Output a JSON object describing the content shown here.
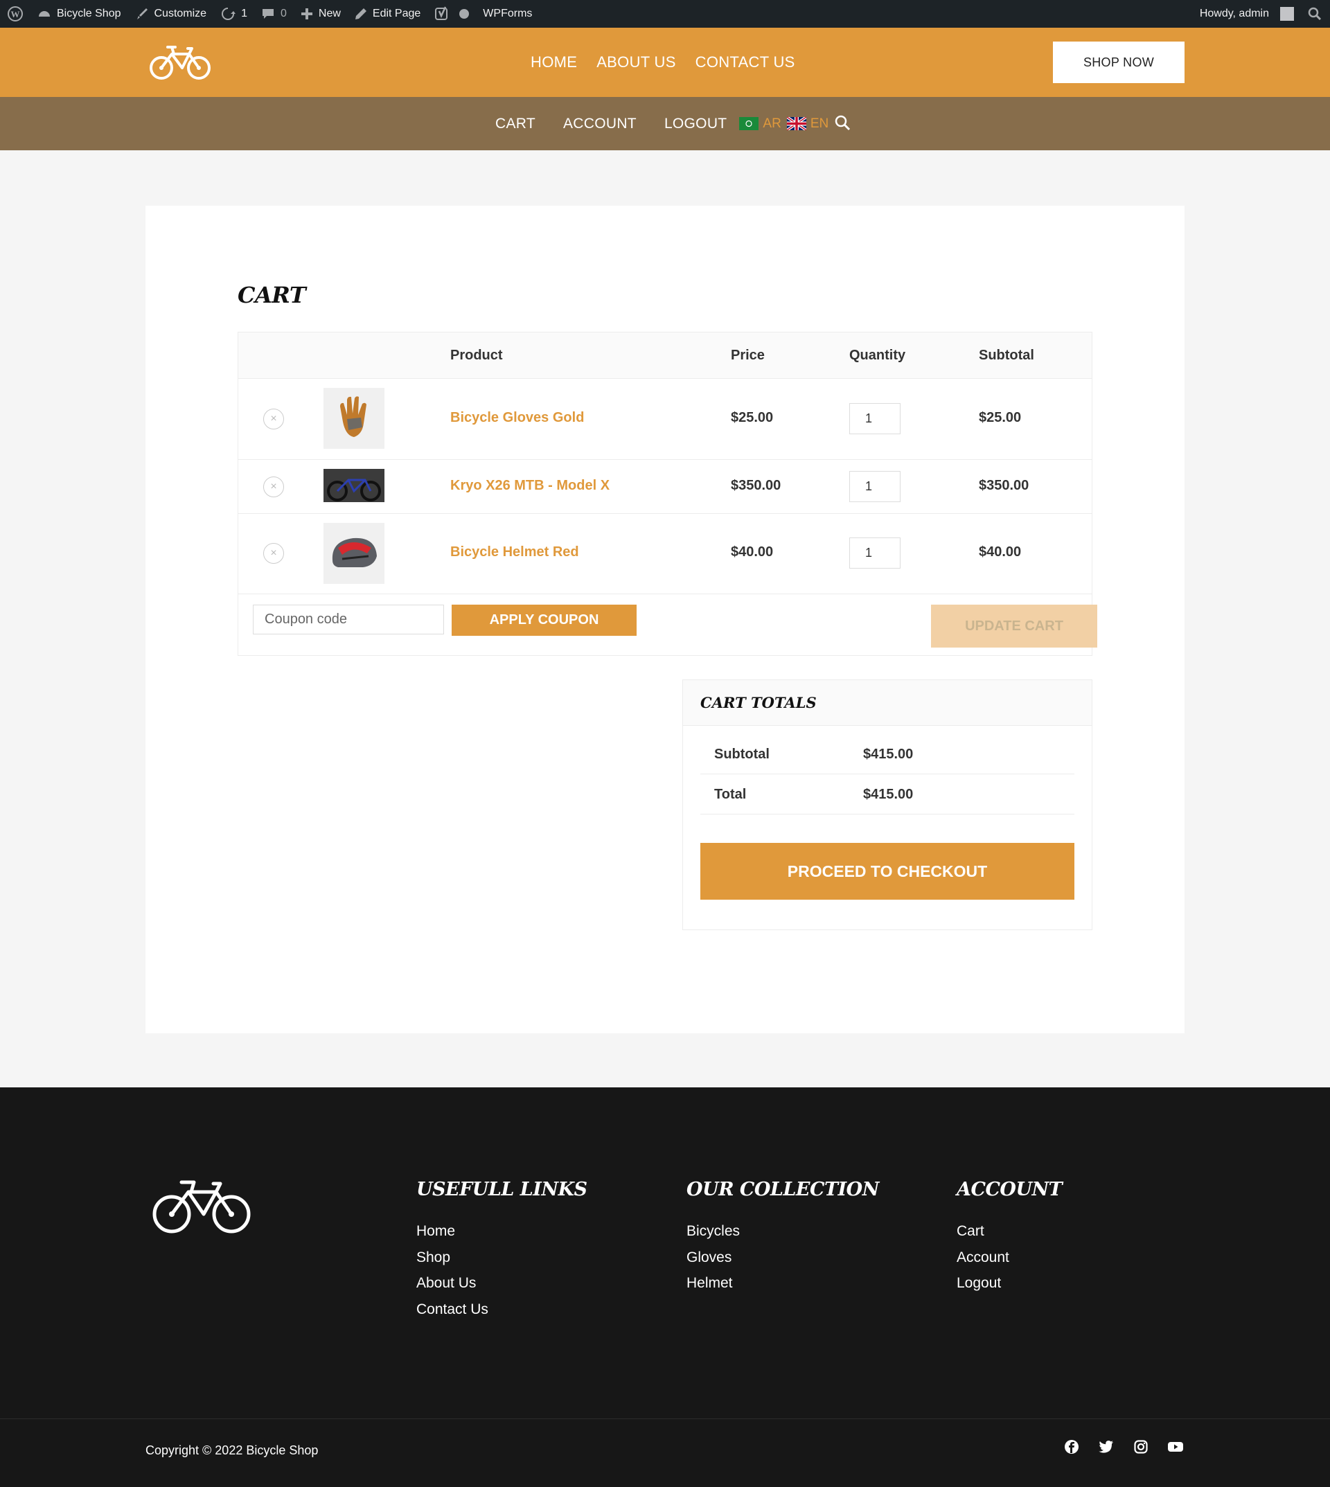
{
  "adminbar": {
    "site_name": "Bicycle Shop",
    "customize": "Customize",
    "updates_count": "1",
    "comments_count": "0",
    "new_label": "New",
    "edit_page": "Edit Page",
    "wpforms": "WPForms",
    "greeting": "Howdy, admin"
  },
  "header": {
    "nav": [
      "HOME",
      "ABOUT US",
      "CONTACT US"
    ],
    "shop_now": "SHOP NOW"
  },
  "subnav": {
    "items": [
      "CART",
      "ACCOUNT",
      "LOGOUT"
    ],
    "lang_ar": "AR",
    "lang_en": "EN"
  },
  "cart": {
    "title": "CART",
    "headers": {
      "product": "Product",
      "price": "Price",
      "quantity": "Quantity",
      "subtotal": "Subtotal"
    },
    "items": [
      {
        "name": "Bicycle Gloves Gold",
        "price": "$25.00",
        "qty": "1",
        "subtotal": "$25.00"
      },
      {
        "name": "Kryo X26 MTB - Model X",
        "price": "$350.00",
        "qty": "1",
        "subtotal": "$350.00"
      },
      {
        "name": "Bicycle Helmet Red",
        "price": "$40.00",
        "qty": "1",
        "subtotal": "$40.00"
      }
    ],
    "coupon_placeholder": "Coupon code",
    "apply_coupon": "APPLY COUPON",
    "update_cart": "UPDATE CART"
  },
  "totals": {
    "title": "CART TOTALS",
    "subtotal_label": "Subtotal",
    "subtotal_value": "$415.00",
    "total_label": "Total",
    "total_value": "$415.00",
    "checkout": "PROCEED TO CHECKOUT"
  },
  "footer": {
    "useful": {
      "title": "USEFULL LINKS",
      "links": [
        "Home",
        "Shop",
        "About Us",
        "Contact Us"
      ]
    },
    "collection": {
      "title": "OUR COLLECTION",
      "links": [
        "Bicycles",
        "Gloves",
        "Helmet"
      ]
    },
    "account": {
      "title": "ACCOUNT",
      "links": [
        "Cart",
        "Account",
        "Logout"
      ]
    },
    "copyright": "Copyright © 2022 Bicycle Shop",
    "social_icons": [
      "facebook-icon",
      "twitter-icon",
      "instagram-icon",
      "youtube-icon"
    ]
  },
  "colors": {
    "accent": "#e0993b",
    "subnav": "#876d4b",
    "footer": "#171717",
    "adminbar": "#1d2327"
  }
}
